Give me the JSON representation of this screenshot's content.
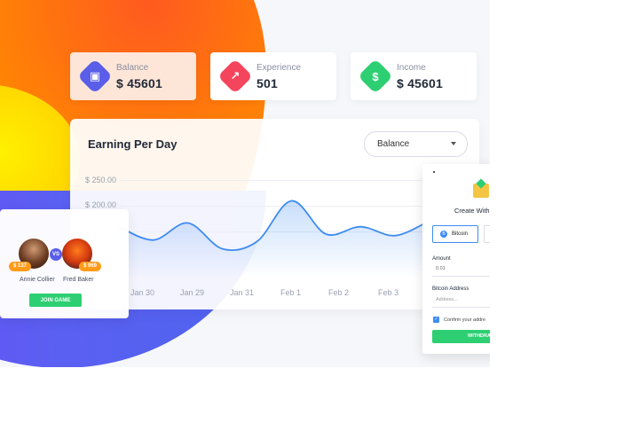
{
  "stats": {
    "balance": {
      "label": "Balance",
      "value": "$ 45601",
      "color": "#5a5ee8"
    },
    "experience": {
      "label": "Experience",
      "value": "501",
      "color": "#f5455c"
    },
    "income": {
      "label": "Income",
      "value": "$ 45601",
      "color": "#2ecf72"
    }
  },
  "chart": {
    "title": "Earning Per Day",
    "dropdown_value": "Balance"
  },
  "chart_data": {
    "type": "line",
    "title": "Earning Per Day",
    "y_tick_labels": [
      "$ 250.00",
      "$ 200.00"
    ],
    "categories": [
      "Jan 30",
      "Jan 29",
      "Jan 31",
      "Feb 1",
      "Feb 2",
      "Feb 3"
    ],
    "line_color": "#3d8bf2",
    "series": [
      {
        "values": [
          170,
          152,
          175,
          140,
          150,
          205,
          160,
          170,
          158,
          178
        ]
      }
    ],
    "ylim": [
      100,
      250
    ],
    "grid": true,
    "area_fill": true
  },
  "game": {
    "player1": {
      "name": "Annie Collier",
      "coins": "$ 137"
    },
    "player2": {
      "name": "Fred Baker",
      "coins": "$ 969"
    },
    "vs_label": "VS",
    "join_button": "JOIN GAME"
  },
  "withdraw": {
    "title": "Create With",
    "tab_bitcoin": "Bitcoin",
    "amount_label": "Amount",
    "amount_value": "0.01",
    "address_label": "Bitcoin Address",
    "address_placeholder": "Address...",
    "confirm_text": "Confirm your addre",
    "submit_button": "WITHDRA"
  }
}
